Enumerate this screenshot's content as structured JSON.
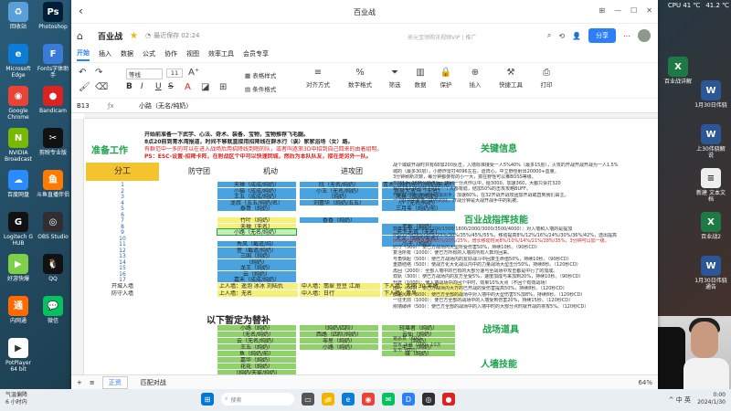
{
  "desktop": {
    "left_icons": [
      {
        "label": "回收站",
        "icon": "recycle-bin-icon",
        "color": "#5aa0d8"
      },
      {
        "label": "Photoshop",
        "icon": "photoshop-icon",
        "color": "#001e36",
        "glyph": "Ps"
      },
      {
        "label": "Microsoft Edge",
        "icon": "edge-icon",
        "color": "#0c7dd6",
        "glyph": "e"
      },
      {
        "label": "Fonts字体助手",
        "icon": "fonts-helper-icon",
        "color": "#3b7bd8",
        "glyph": "F"
      },
      {
        "label": "Google Chrome",
        "icon": "chrome-icon",
        "color": "#e84335",
        "glyph": "◉"
      },
      {
        "label": "Bandicam",
        "icon": "bandicam-icon",
        "color": "#d22",
        "glyph": "●"
      },
      {
        "label": "NVIDIA Broadcast",
        "icon": "nvidia-icon",
        "color": "#76b900",
        "glyph": "N"
      },
      {
        "label": "剪映专业版",
        "icon": "jianying-icon",
        "color": "#111",
        "glyph": "✂"
      },
      {
        "label": "百度网盘",
        "icon": "baidu-pan-icon",
        "color": "#2a8bff",
        "glyph": "☁"
      },
      {
        "label": "斗鱼直播伴侣",
        "icon": "douyu-icon",
        "color": "#ff7a00",
        "glyph": "鱼"
      },
      {
        "label": "Logitech G HUB",
        "icon": "ghub-icon",
        "color": "#111",
        "glyph": "G"
      },
      {
        "label": "OBS Studio",
        "icon": "obs-icon",
        "color": "#302e31",
        "glyph": "◎"
      },
      {
        "label": "好游快爆",
        "icon": "haoyou-icon",
        "color": "#7fd049",
        "glyph": "▶"
      },
      {
        "label": "QQ",
        "icon": "qq-icon",
        "color": "#111",
        "glyph": "🐧"
      },
      {
        "label": "内网通",
        "icon": "neiwangtong-icon",
        "color": "#ff6a00",
        "glyph": "通"
      },
      {
        "label": "微信",
        "icon": "wechat-icon",
        "color": "#07c160",
        "glyph": "💬"
      },
      {
        "label": "PotPlayer 64 bit",
        "icon": "potplayer-icon",
        "color": "#fff",
        "glyph": "▶"
      }
    ],
    "right_icons": [
      {
        "label": "百业战详解",
        "icon": "excel-file-icon",
        "color": "#1e7a45",
        "glyph": "X"
      },
      {
        "label": "1月30日伟骁",
        "icon": "word-file-icon",
        "color": "#2b5797",
        "glyph": "W"
      },
      {
        "label": "上30伟骁解说",
        "icon": "word-file-icon",
        "color": "#2b5797",
        "glyph": "W"
      },
      {
        "label": "新建 文本文档",
        "icon": "text-file-icon",
        "color": "#eee",
        "glyph": "≡"
      },
      {
        "label": "百业战2",
        "icon": "excel-file-icon",
        "color": "#1e7a45",
        "glyph": "X"
      },
      {
        "label": "1月30日伟骁 通告",
        "icon": "word-file-icon",
        "color": "#2b5797",
        "glyph": "W"
      }
    ],
    "sys_top": {
      "cpu": "CPU 41 ℃",
      "gpu": "41.2 ℃"
    }
  },
  "window": {
    "title": "百业战",
    "doc_title": "百业战",
    "saved_text": "最近保存 02:24",
    "vip_text": "来元宝领购讯视频VIP | 推广",
    "share_label": "分享",
    "menu_tabs": [
      "开始",
      "插入",
      "数据",
      "公式",
      "协作",
      "视图",
      "效率工具",
      "会员专享"
    ],
    "active_tab": "开始",
    "ribbon": {
      "font_name": "等线",
      "font_size": "11",
      "table_style": "表格样式",
      "cond_format": "条件格式",
      "align": "对齐方式",
      "number_format": "数字格式",
      "filter": "筛选",
      "data": "数据",
      "protect": "保护",
      "insert": "插入",
      "quick_tools": "快捷工具",
      "print": "打印"
    },
    "cell_ref": "B13",
    "formula_value": "小路（无名/纯奶）",
    "sheet_tabs": [
      "正资",
      "匹配对战"
    ],
    "active_sheet": "正资",
    "zoom": "64%"
  },
  "sheet": {
    "left_header": "准备工作",
    "notes": [
      "开始前准备一下武学、心法、奇术、装备、宝物，宝物推荐飞毛腿。",
      "8点20前到青水湾报道，时间不够就直接用招降线在群水行（诶）家家浴场（女）路。",
      "有群范中一多的可以在进入战场后用招降线到嗯的队，或者叫逐渐3D中招到自己回来的由着组明。",
      "PS：ESC-设置-招降卡阵，在射战区个中可以快速回城，然后为本队队友，接在是另外一队。"
    ],
    "col_headers": [
      "分工",
      "防守团",
      "机动",
      "进攻团"
    ],
    "row_numbers": [
      "1",
      "2",
      "3",
      "4",
      "5",
      "6",
      "7",
      "8",
      "9",
      "10",
      "11",
      "12",
      "13",
      "14",
      "15",
      "16",
      "17",
      "18",
      "19",
      "20"
    ],
    "defense_rows": [
      "天禅（成成/纯奶）",
      "小猫（成成/纯奶）",
      "王五（成成/纯奶）",
      "龙叔（五五/纯奶/名）",
      "泰哥（纯奶）",
      "",
      "竹叶（纯奶）",
      "天禅（无名）",
      "小路（无名/纯奶）",
      "",
      "秀风（截道/纯）",
      "萱（截道/纯奶）",
      "三国（纯奶）",
      "（纯奶）",
      "龙王（纯奶）",
      "云（纯奶）",
      "嘉禾（成成/纯奶）"
    ],
    "mobile_rows": [
      "阮（无名/纯奶）",
      "小玉（无名/纯奶）",
      "（纯奶）",
      "刘蕾华（纯奶/五五）",
      "",
      "",
      "香香（纯奶）",
      "",
      "",
      "",
      "",
      "",
      "",
      "",
      "",
      "",
      ""
    ],
    "attack_rows": [
      "青术（纯奶/前行/纯奶/前元）",
      "我亲大放马（无名）",
      "风景（成成/纯奶）",
      "小（无名/纯奶）",
      "三月零（纯奶/前）",
      "",
      "",
      "老板（纯奶）",
      "天下无双（无名）",
      "大文（纯奶/无名）",
      "小子（纯奶）",
      "",
      "",
      "",
      "",
      "",
      ""
    ],
    "summary_rows": [
      {
        "label": "开城入墙",
        "c1": "上人墙：遥泡 冰冰 刘陆仇",
        "c2": "中人墙：翡翠 豆豆 江湖",
        "c3": "下人墙：大闸 30 零墩"
      },
      {
        "label": "防守入墙",
        "c1": "上人墙：无名",
        "c2": "中人墙：日行",
        "c3": "下人墙：青风"
      }
    ],
    "lower_title": "以下暂定为替补",
    "lower_defense": [
      "小路（纯奶）",
      "（无名/纯奶）",
      "云（无名/纯奶）",
      "王五（纯奶）",
      "鱼（纯奶/前）",
      "嘉华（纯奶）",
      "花花（纯奶）",
      "（纯奶/天雾/纯奶）"
    ],
    "lower_mobile": [
      "（纯奶/四阶）",
      "西路（四阶/纯奶）",
      "零星（纯奶）",
      "小路（纯奶）",
      "",
      "",
      "",
      ""
    ],
    "lower_attack": [
      "轻堪者（纯奶）",
      "云仙（纯奶）",
      "（纯奶）",
      "老王（纯奶）",
      "雄（纯奶）",
      "",
      "",
      ""
    ],
    "key_info_title": "关键信息",
    "key_info_text": [
      "战个或联开战时共有68加200反击，入墙标准接受一人5%40%（最多15层），火攻的开战开战开战为一人1.5%",
      "城的（最多30层），小野炸雷打4096左右，遗阵心，中立野怪射出20000+血量。",
      "3分钟刷新次数，每分钟都要有的小一大，搞在野怪可以推BOSS等级。",
      "攻防14+26时分钟击后，接刷一分点作以中，给3000，加速360，大都只会打320",
      "现在14+16分钟止的由一个大都有稳，结加50%的击攻攻略BUFF。",
      "开启时分钟分钟刷手动拔出手，加速60%，在32开战开战攻团加开战或直到我们由主。",
      "一个联共中攻击（由与的好，开战分钟是大战开战手中的机被。"
    ],
    "command_title": "百业战指挥技能",
    "command_text": [
      "鼓舞士气（1000/1200/1500/1800/2000/3000/3500/4000）：对入墙和入墙的是提加",
      "8%/12%/16%/20%/25%/30%/35%/45%/55%，移动提高8%/12%/16%/24%/30%/36%/42%，选出提高",
      "8%/10%/8%/10%/15%/20%/25%，增长移动时间8%/10%/14%/21%/28%/35%，3分钟可以加一级。",
      "防守（500）：使已方战场内大型所受伤害50%，持续10秒。（90秒CD）",
      "复活所有（1000）：使已方所有的入墙的所有人数均回来。",
      "号角快起（500）：使已方战场内的友好战斗中回复生命值50%，持续10秒。（90秒CD）",
      "重筋结络（500）：使战方化大化战以内中的力量战场大型击分50%，持续8秒。（120秒CD）",
      "再回（2000）：全部入墙中的已有的大部分速与全战场中攻击都是中行了的加成。",
      "双轨（300）：使已方战场内的友方全受5%，速度加成与来加到20%，持续10秒。（90秒CD）",
      "升阵（1000）：使入墙战场中的回个中时，效果10%大点（不回个有效战场）",
      "围行（500）：使已方战场内大方的已开战的受伤害提高50%，持续8秒。（120秒CD）",
      "群雄风华（500）：使已方全部的战场中对入墙中的大型伤害5%加8%，持续8秒。（120秒CD）",
      "一往无前（1000）：使已方全部的战场中的入墙受到伤害20%，持续15秒。（120秒CD）",
      "刚墙破碎（500）：使已方全部的战场中的入墙中时的大部分点时就开战的将攻5%。（120秒CD）"
    ],
    "items_title": "战场道具",
    "items_text": [
      "锯恶意（600）",
      "营攻 飞溅（200）10次",
      "车市（600）"
    ],
    "wall_title": "人墙技能"
  },
  "taskbar": {
    "weather_line1": "气温偏降",
    "weather_line2": "6 小时内",
    "search_placeholder": "搜索",
    "clock_time": "0:00",
    "clock_date": "2024/1/30",
    "tray_text": "^ 中 英"
  },
  "colors": {
    "accent": "#2d7ff9",
    "header_yellow": "#f4c430",
    "cell_blue": "#4aa3df",
    "cell_green": "#8fd16a",
    "green_title": "#19a34a",
    "red_note": "#e02020"
  }
}
